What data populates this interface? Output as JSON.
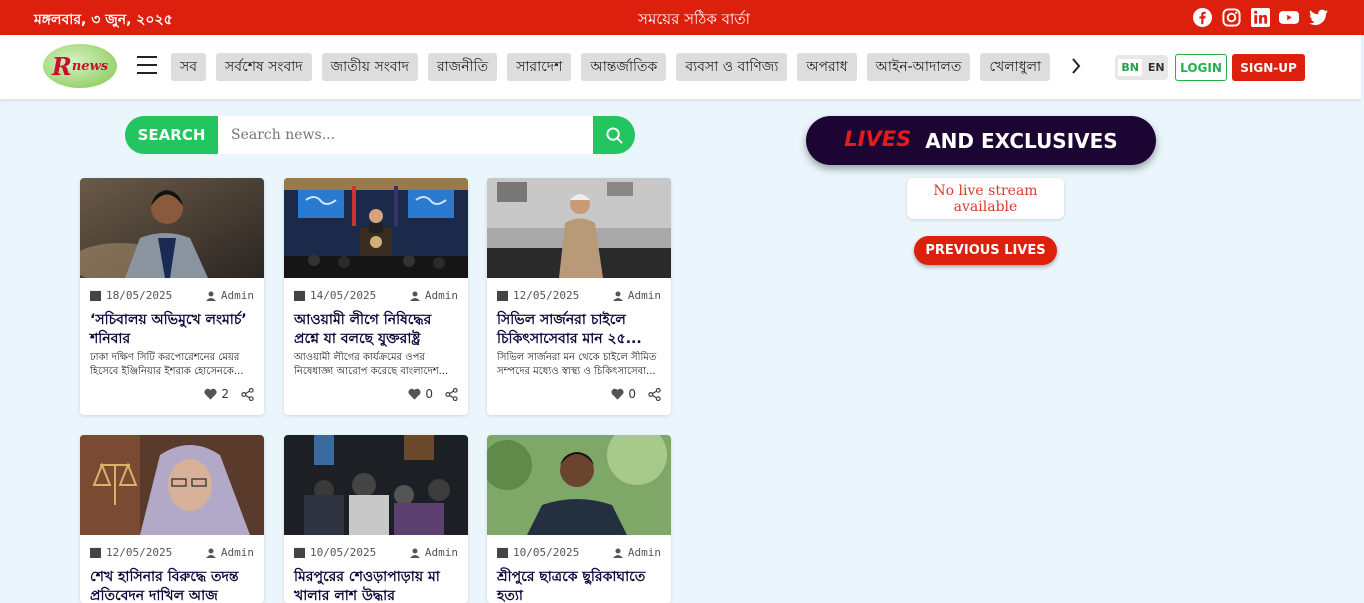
{
  "topbar": {
    "date": "মঙ্গলবার, ৩ জুন, ২০২৫",
    "slogan": "সময়ের সঠিক বার্তা",
    "social_icons": [
      "facebook-icon",
      "instagram-icon",
      "linkedin-icon",
      "youtube-icon",
      "twitter-icon"
    ]
  },
  "nav": {
    "logo_text_r": "R",
    "logo_text_news": "news",
    "categories": [
      "সব",
      "সর্বশেষ সংবাদ",
      "জাতীয় সংবাদ",
      "রাজনীতি",
      "সারাদেশ",
      "আন্তর্জাতিক",
      "ব্যবসা ও বাণিজ্য",
      "অপরাধ",
      "আইন-আদালত",
      "খেলাধুলা"
    ],
    "lang_bn": "BN",
    "lang_en": "EN",
    "login": "LOGIN",
    "signup": "SIGN-UP"
  },
  "search": {
    "label": "SEARCH",
    "placeholder": "Search news..."
  },
  "articles": [
    {
      "date": "18/05/2025",
      "author": "Admin",
      "title": "‘সচিবালয় অভিমুখে লংমার্চ’ শনিবার",
      "excerpt": "ঢাকা দক্ষিণ সিটি করপোরেশনের মেয়র হিসেবে ইঞ্জিনিয়ার ইশরাক হোসেনকে...",
      "likes": "2"
    },
    {
      "date": "14/05/2025",
      "author": "Admin",
      "title": "আওয়ামী লীগে নিষিদ্ধের প্রশ্নে যা বলছে যুক্তরাষ্ট্র",
      "excerpt": "আওয়ামী লীগের কার্যক্রমের ওপর নিষেধাজ্ঞা আরোপ করেছে বাংলাদেশ...",
      "likes": "0"
    },
    {
      "date": "12/05/2025",
      "author": "Admin",
      "title": "সিভিল সার্জনরা চাইলে চিকিৎসাসেবার মান ২৫...",
      "excerpt": "সিভিল সার্জনরা মন থেকে চাইলে সীমিত সম্পদের মধ্যেও স্বাস্থ্য ও চিকিৎসাসেবা...",
      "likes": "0"
    },
    {
      "date": "12/05/2025",
      "author": "Admin",
      "title": "শেখ হাসিনার বিরুদ্ধে তদন্ত প্রতিবেদন দাখিল আজ",
      "excerpt": "",
      "likes": ""
    },
    {
      "date": "10/05/2025",
      "author": "Admin",
      "title": "মিরপুরের শেওড়াপাড়ায় মা খালার লাশ উদ্ধার",
      "excerpt": "",
      "likes": ""
    },
    {
      "date": "10/05/2025",
      "author": "Admin",
      "title": "শ্রীপুরে ছাত্রকে ছুরিকাঘাতে হত্যা",
      "excerpt": "",
      "likes": ""
    }
  ],
  "live": {
    "lives": "LIVES",
    "rest": "AND EXCLUSIVES",
    "no_stream": "No live stream available",
    "previous": "PREVIOUS LIVES"
  },
  "colors": {
    "brand_red": "#dd1f0e",
    "accent_green": "#22c55e",
    "live_banner": "#1c0533",
    "page_bg": "#eaf6fb"
  }
}
